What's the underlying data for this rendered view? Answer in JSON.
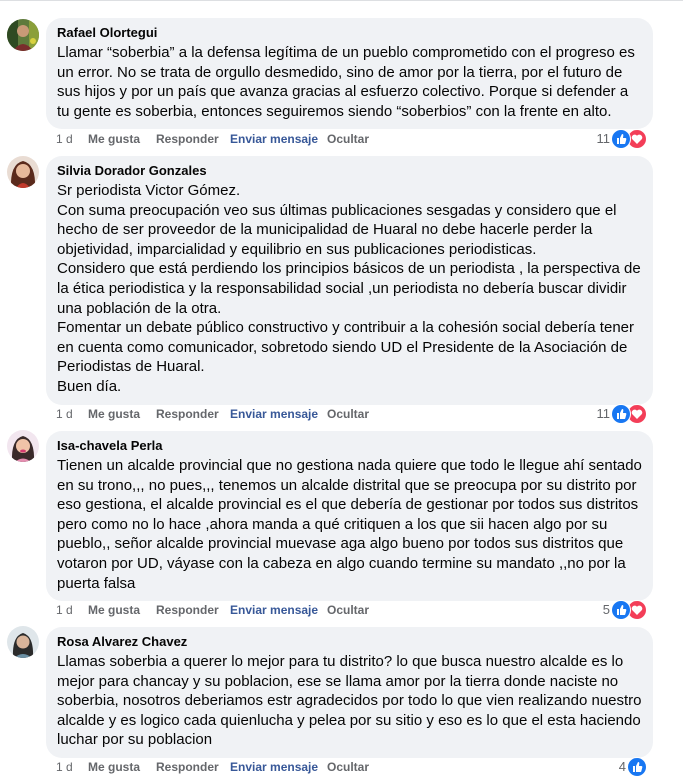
{
  "labels": {
    "time": "1 d",
    "like": "Me gusta",
    "reply": "Responder",
    "send": "Enviar mensaje",
    "hide": "Ocultar"
  },
  "colors": {
    "bubble": "#f0f2f5",
    "link_blue": "#385898",
    "meta_gray": "#65676b",
    "like_blue": "#1877f2",
    "love_red": "#f33e58"
  },
  "icons": {
    "like": "thumbs-up-icon",
    "love": "heart-icon"
  },
  "comments": [
    {
      "author": "Rafael Olortegui",
      "text": "Llamar “soberbia” a la defensa legítima de un pueblo comprometido con el progreso es un error. No se trata de orgullo desmedido, sino de amor por la tierra, por el futuro de sus hijos y por un país que avanza gracias al esfuerzo colectivo. Porque si defender a tu gente es soberbia, entonces seguiremos siendo “soberbios” con la frente en alto.",
      "reactions": "11"
    },
    {
      "author": "Silvia Dorador Gonzales",
      "text": "Sr periodista Victor Gómez.\nCon suma preocupación veo sus últimas publicaciones sesgadas y considero que el hecho de ser proveedor de la municipalidad de Huaral no debe hacerle perder la objetividad, imparcialidad y equilibrio en sus publicaciones periodisticas.\nConsidero que está perdiendo los principios básicos de un periodista , la perspectiva de la ética periodistica y la responsabilidad social ,un periodista no debería buscar dividir una población de la otra.\nFomentar un debate público constructivo y contribuir a la cohesión social debería tener en cuenta como comunicador, sobretodo siendo UD el Presidente de la Asociación de Periodistas de Huaral.\nBuen día.",
      "reactions": "11"
    },
    {
      "author": "Isa-chavela Perla",
      "text": "Tienen un alcalde provincial que no gestiona nada quiere que todo le llegue ahí sentado en su trono,,, no pues,,, tenemos un alcalde distrital que se preocupa por su distrito por eso gestiona, el alcalde provincial es el que debería de gestionar por todos sus distritos pero como no lo hace ,ahora manda a qué critiquen a los que sii hacen algo por su pueblo,, señor alcalde provincial muevase aga algo bueno por todos sus distritos que votaron por UD, váyase con la cabeza en algo cuando termine su mandato ,,no por la puerta falsa",
      "reactions": "5"
    },
    {
      "author": "Rosa Alvarez Chavez",
      "text": "Llamas soberbia a querer lo mejor para tu distrito? lo que busca nuestro alcalde es lo mejor para chancay y su poblacion, ese se llama amor por la tierra donde naciste no soberbia, nosotros deberiamos estr agradecidos por todo lo que vien realizando nuestro alcalde y es logico cada quienlucha y pelea por su sitio y eso es lo que el esta haciendo luchar por su poblacion",
      "reactions": "4"
    }
  ]
}
